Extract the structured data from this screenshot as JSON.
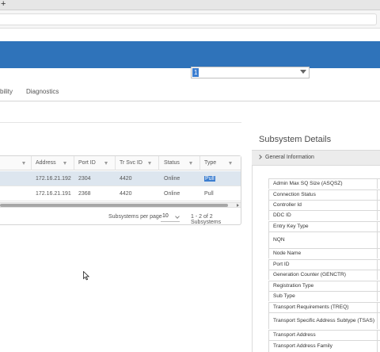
{
  "browser": {
    "new_tab_glyph": "+"
  },
  "filter": {
    "selected": "1"
  },
  "tabs": [
    {
      "label": "bility"
    },
    {
      "label": "Diagnostics"
    }
  ],
  "table": {
    "columns": [
      {
        "label": ""
      },
      {
        "label": "Address"
      },
      {
        "label": "Port ID"
      },
      {
        "label": "Tr Svc ID"
      },
      {
        "label": "Status"
      },
      {
        "label": "Type"
      }
    ],
    "rows": [
      {
        "address": "172.16.21.192",
        "port_id": "2304",
        "tr_svc_id": "4420",
        "status": "Online",
        "type": "Pull",
        "selected": true
      },
      {
        "address": "172.16.21.191",
        "port_id": "2368",
        "tr_svc_id": "4420",
        "status": "Online",
        "type": "Pull",
        "selected": false
      }
    ],
    "footer": {
      "per_page_label": "Subsystems per page",
      "per_page_value": "10",
      "range": "1 - 2 of 2 Subsystems"
    }
  },
  "details": {
    "title": "Subsystem Details",
    "section": "General Information",
    "properties": [
      "Admin Max SQ Size (ASQSZ)",
      "Connection Status",
      "Controller Id",
      "DDC ID",
      "Entry Key Type",
      "NQN",
      "Node Name",
      "Port ID",
      "Generation Counter (GENCTR)",
      "Registration Type",
      "Sub Type",
      "Transport Requirements (TREQ)",
      "Transport Specific Address Subtype (TSAS)",
      "Transport Address",
      "Transport Address Family"
    ]
  },
  "icons": {
    "filter": "funnel-icon",
    "dropdown": "caret-down-icon",
    "expand": "chevron-right-icon",
    "pointer": "mouse-cursor-icon"
  }
}
